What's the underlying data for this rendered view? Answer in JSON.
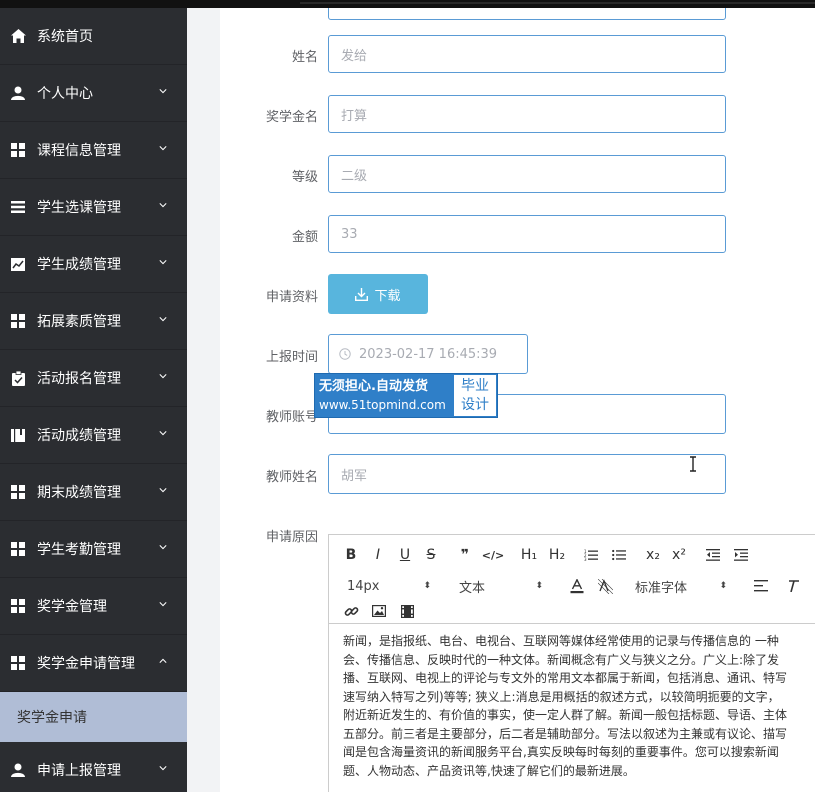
{
  "sidebar": {
    "items": [
      {
        "label": "系统首页",
        "icon": "home-icon",
        "chevron": false
      },
      {
        "label": "个人中心",
        "icon": "user-icon",
        "chevron": true
      },
      {
        "label": "课程信息管理",
        "icon": "grid-icon",
        "chevron": true
      },
      {
        "label": "学生选课管理",
        "icon": "list-icon",
        "chevron": true
      },
      {
        "label": "学生成绩管理",
        "icon": "chart-icon",
        "chevron": true
      },
      {
        "label": "拓展素质管理",
        "icon": "grid-icon",
        "chevron": true
      },
      {
        "label": "活动报名管理",
        "icon": "clipboard-icon",
        "chevron": true
      },
      {
        "label": "活动成绩管理",
        "icon": "book-icon",
        "chevron": true
      },
      {
        "label": "期末成绩管理",
        "icon": "grid-icon",
        "chevron": true
      },
      {
        "label": "学生考勤管理",
        "icon": "grid-icon",
        "chevron": true
      },
      {
        "label": "奖学金管理",
        "icon": "grid-icon",
        "chevron": true
      },
      {
        "label": "奖学金申请管理",
        "icon": "grid-icon",
        "chevron": true,
        "open": true
      }
    ],
    "submenu": {
      "label": "奖学金申请"
    },
    "last_item": {
      "label": "申请上报管理",
      "icon": "user-icon"
    }
  },
  "form": {
    "name": {
      "label": "姓名",
      "value": "发给"
    },
    "scholarship_name": {
      "label": "奖学金名",
      "value": "打算"
    },
    "level": {
      "label": "等级",
      "value": "二级"
    },
    "amount": {
      "label": "金额",
      "value": "33"
    },
    "materials": {
      "label": "申请资料",
      "button": "下载"
    },
    "report_time": {
      "label": "上报时间",
      "value": "2023-02-17 16:45:39"
    },
    "teacher_account": {
      "label": "教师账号",
      "value": ""
    },
    "teacher_name": {
      "label": "教师姓名",
      "value": "胡军"
    },
    "reason": {
      "label": "申请原因"
    }
  },
  "editor": {
    "font_size": "14px",
    "text_type": "文本",
    "font_family": "标准字体",
    "buttons_row1": [
      "B",
      "I",
      "U",
      "S",
      "❞",
      "</>",
      "H₁",
      "H₂",
      "ol",
      "ul",
      "x₂",
      "x²",
      "outdent",
      "indent"
    ],
    "content_lines": [
      "新闻，是指报纸、电台、电视台、互联网等媒体经常使用的记录与传播信息的 一种",
      "会、传播信息、反映时代的一种文体。新闻概念有广义与狭义之分。广义上:除了发",
      "播、互联网、电视上的评论与专文外的常用文本都属于新闻，包括消息、通讯、特写",
      "速写纳入特写之列)等等; 狭义上:消息是用概括的叙述方式，以较简明扼要的文字，",
      "附近新近发生的、有价值的事实，使一定人群了解。新闻一般包括标题、导语、主体",
      "五部分。前三者是主要部分，后二者是辅助部分。写法以叙述为主兼或有议论、描写",
      "闻是包含海量资讯的新闻服务平台,真实反映每时每刻的重要事件。您可以搜索新闻",
      "题、人物动态、产品资讯等,快速了解它们的最新进展。"
    ]
  },
  "watermark": {
    "line1": "无须担心.自动发货",
    "line2": "www.51topmind.com",
    "right1": "毕业",
    "right2": "设计"
  },
  "colors": {
    "sidebar_bg": "#2b2d31",
    "submenu_bg": "#b0bdd6",
    "input_border": "#5a9bd5",
    "button_bg": "#58b5dd",
    "watermark_bg": "#2f7fc8"
  }
}
